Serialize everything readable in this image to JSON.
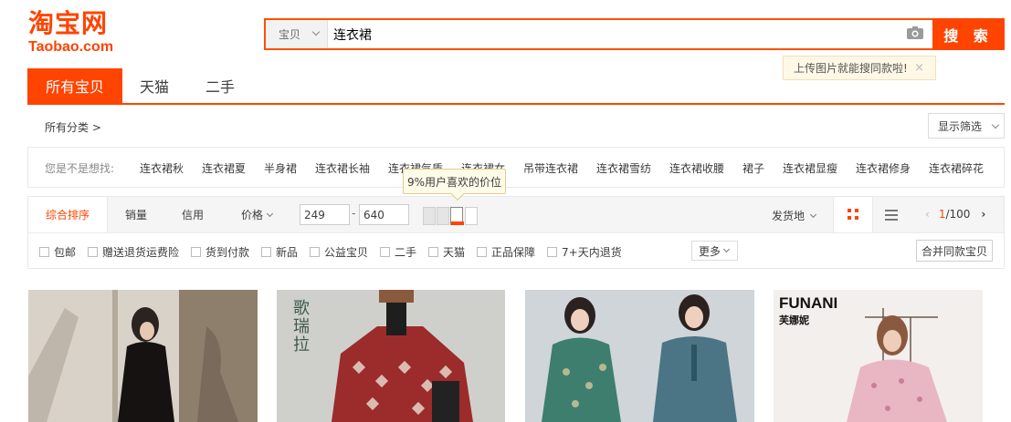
{
  "logo": {
    "cn": "淘宝网",
    "en": "Taobao.com",
    "color": "#ff4400"
  },
  "search": {
    "type_label": "宝贝",
    "query": "连衣裙",
    "button_label": "搜 索",
    "image_search_tooltip": "上传图片就能搜同款啦!",
    "close_symbol": "×"
  },
  "tabs": [
    {
      "label": "所有宝贝",
      "active": true
    },
    {
      "label": "天猫",
      "active": false
    },
    {
      "label": "二手",
      "active": false
    }
  ],
  "category": {
    "label": "所有分类 >",
    "filter_toggle": "显示筛选"
  },
  "suggestions": {
    "label": "您是不是想找:",
    "items": [
      "连衣裙秋",
      "连衣裙夏",
      "半身裙",
      "连衣裙长袖",
      "连衣裙气质",
      "连衣裙女",
      "吊带连衣裙",
      "连衣裙雪纺",
      "连衣裙收腰",
      "裙子",
      "连衣裙显瘦",
      "连衣裙修身",
      "连衣裙碎花"
    ]
  },
  "sort": {
    "tabs": [
      {
        "label": "综合排序",
        "active": true
      },
      {
        "label": "销量",
        "active": false
      },
      {
        "label": "信用",
        "active": false
      },
      {
        "label": "价格",
        "active": false
      }
    ],
    "price_min": "249",
    "price_max": "640",
    "price_dash": "-",
    "price_tooltip": "9%用户喜欢的价位",
    "ship_from": "发货地",
    "page_current": "1",
    "page_total": "/100"
  },
  "checkboxes": [
    "包邮",
    "赠送退货运费险",
    "货到付款",
    "新品",
    "公益宝贝",
    "二手",
    "天猫",
    "正品保障",
    "7+天内退货"
  ],
  "more_label": "更多",
  "merge_label": "合并同款宝贝",
  "products": [
    {
      "brand_text": ""
    },
    {
      "brand_text": "歌瑞拉"
    },
    {
      "brand_text": ""
    },
    {
      "brand_text": "FUNANI",
      "brand_sub": "芙娜妮"
    }
  ],
  "accent_color": "#ff4400"
}
